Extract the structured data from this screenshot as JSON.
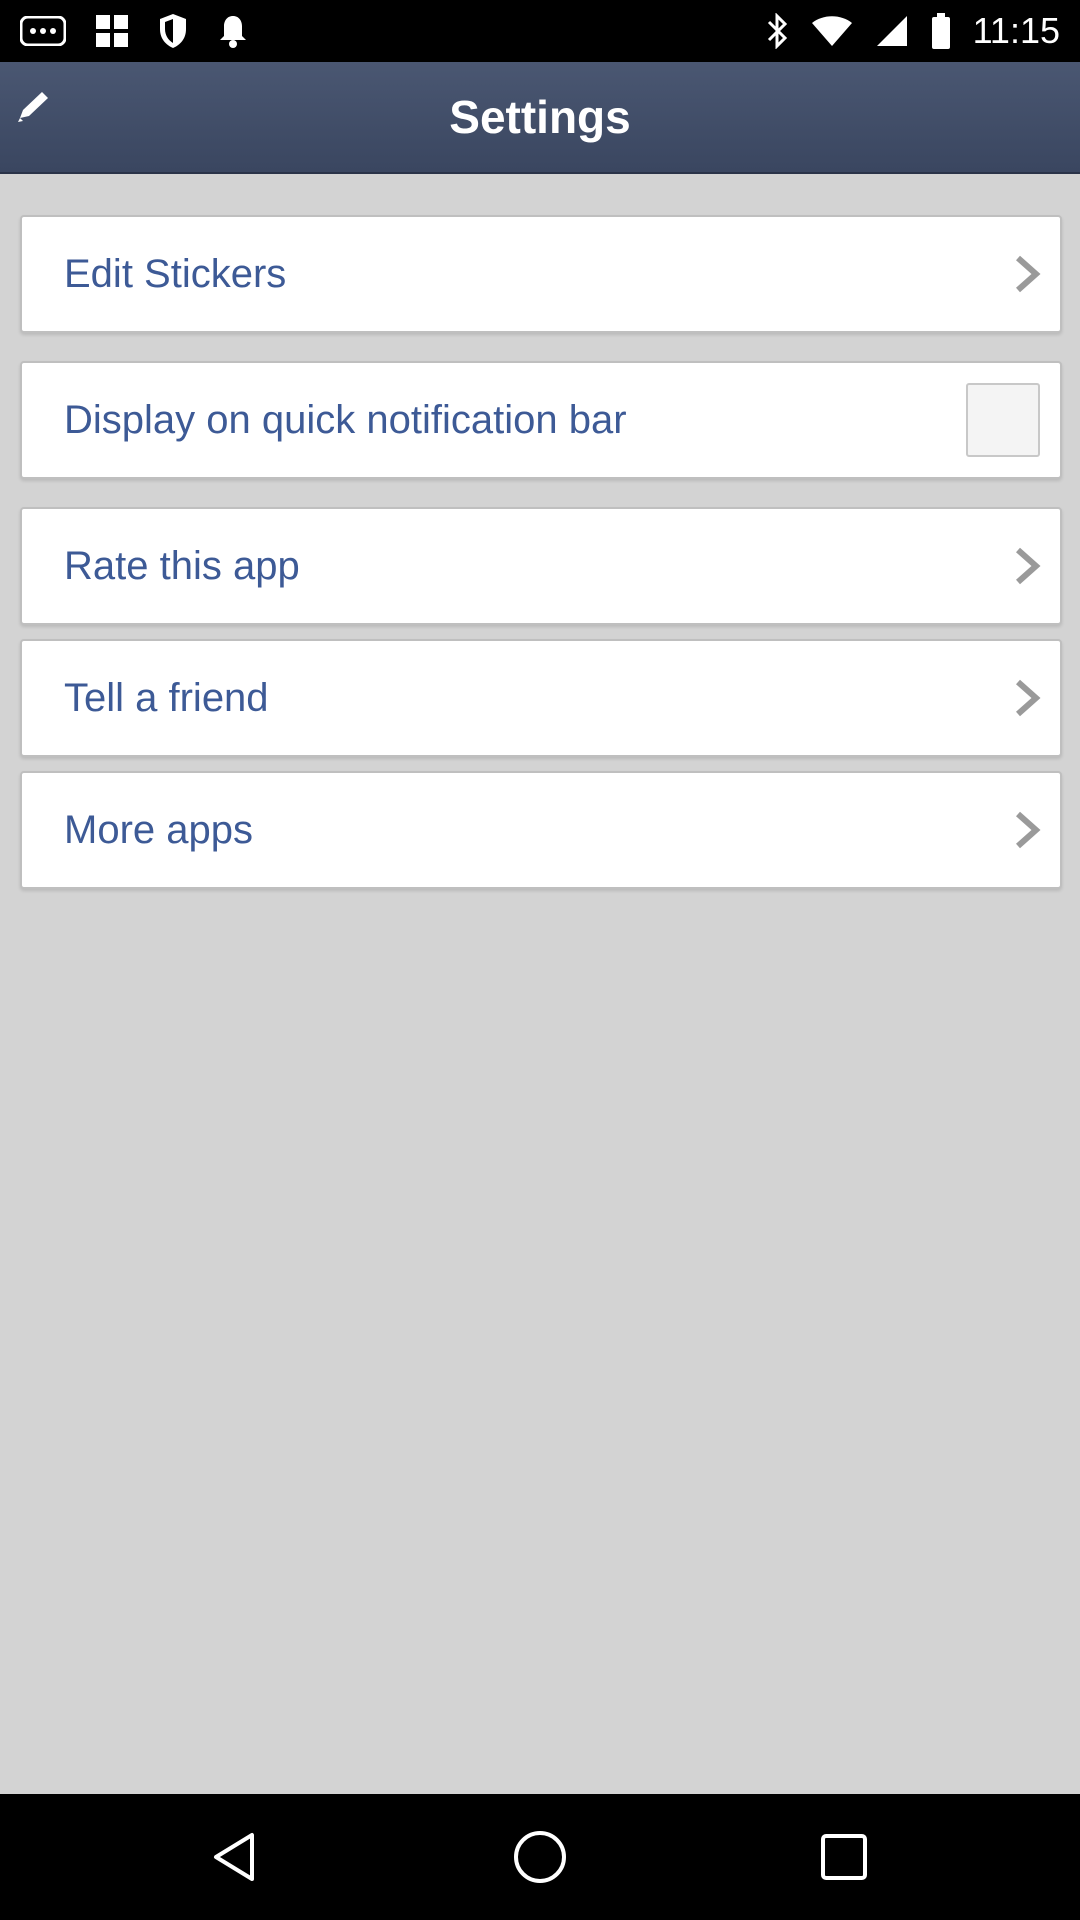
{
  "status_bar": {
    "time": "11:15",
    "left_icons": [
      "more-notifications-icon",
      "app-grid-icon",
      "security-shield-icon",
      "notification-bell-icon"
    ],
    "right_icons": [
      "bluetooth-icon",
      "wifi-icon",
      "cell-signal-icon",
      "battery-icon"
    ]
  },
  "app_bar": {
    "title": "Settings",
    "left_icon": "edit-pencil-icon"
  },
  "settings": {
    "items": [
      {
        "label": "Edit Stickers",
        "control": "chevron"
      },
      {
        "label": "Display on quick notification bar",
        "control": "checkbox",
        "checked": false
      },
      {
        "label": "Rate this app",
        "control": "chevron"
      },
      {
        "label": "Tell a friend",
        "control": "chevron"
      },
      {
        "label": "More apps",
        "control": "chevron"
      }
    ]
  },
  "nav_bar": {
    "buttons": [
      "back-icon",
      "home-icon",
      "recents-icon"
    ]
  },
  "colors": {
    "app_bar": "#3f4b66",
    "label_text": "#3d5a96",
    "background": "#d3d3d3"
  }
}
